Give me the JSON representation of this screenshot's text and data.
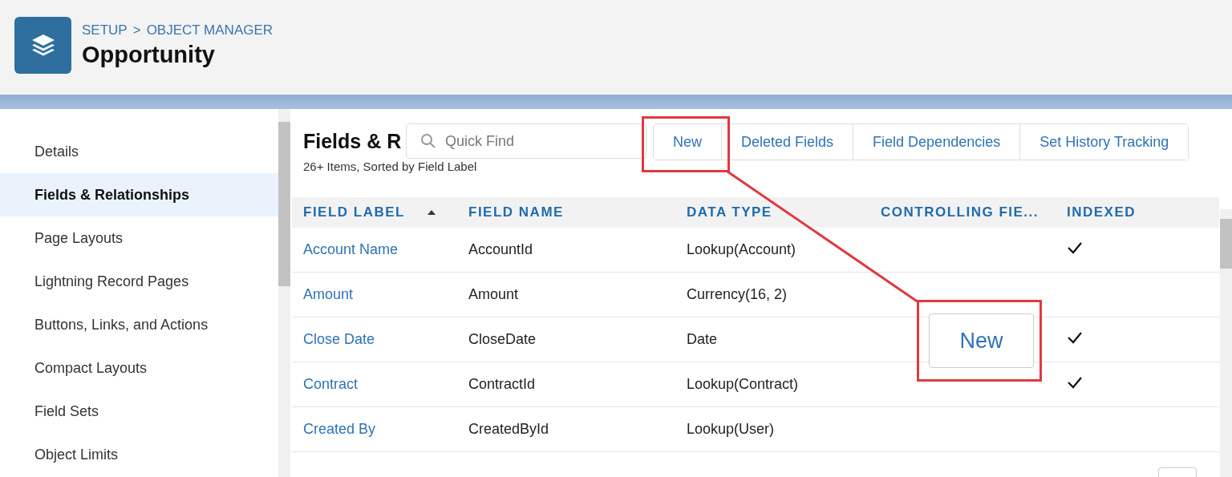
{
  "header": {
    "breadcrumb": [
      "SETUP",
      "OBJECT MANAGER"
    ],
    "separator": ">",
    "title": "Opportunity"
  },
  "sidebar": {
    "items": [
      {
        "label": "Details",
        "selected": false
      },
      {
        "label": "Fields & Relationships",
        "selected": true
      },
      {
        "label": "Page Layouts",
        "selected": false
      },
      {
        "label": "Lightning Record Pages",
        "selected": false
      },
      {
        "label": "Buttons, Links, and Actions",
        "selected": false
      },
      {
        "label": "Compact Layouts",
        "selected": false
      },
      {
        "label": "Field Sets",
        "selected": false
      },
      {
        "label": "Object Limits",
        "selected": false
      }
    ]
  },
  "section": {
    "heading": "Fields & R",
    "subtitle": "26+ Items, Sorted by Field Label"
  },
  "search": {
    "placeholder": "Quick Find"
  },
  "buttons": [
    "New",
    "Deleted Fields",
    "Field Dependencies",
    "Set History Tracking"
  ],
  "table": {
    "columns": [
      {
        "label": "FIELD LABEL",
        "sorted": true
      },
      {
        "label": "FIELD NAME",
        "sorted": false
      },
      {
        "label": "DATA TYPE",
        "sorted": false
      },
      {
        "label": "CONTROLLING FIE...",
        "sorted": false
      },
      {
        "label": "INDEXED",
        "sorted": false
      }
    ],
    "rows": [
      {
        "label": "Account Name",
        "name": "AccountId",
        "type": "Lookup(Account)",
        "indexed": true
      },
      {
        "label": "Amount",
        "name": "Amount",
        "type": "Currency(16, 2)",
        "indexed": false
      },
      {
        "label": "Close Date",
        "name": "CloseDate",
        "type": "Date",
        "indexed": true
      },
      {
        "label": "Contract",
        "name": "ContractId",
        "type": "Lookup(Contract)",
        "indexed": true
      },
      {
        "label": "Created By",
        "name": "CreatedById",
        "type": "Lookup(User)",
        "indexed": false
      }
    ]
  },
  "callout": {
    "label": "New"
  }
}
